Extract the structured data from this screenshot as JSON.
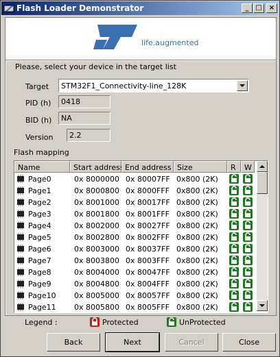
{
  "window": {
    "title": "Flash Loader Demonstrator",
    "controls": {
      "minimize": "_",
      "maximize": "□",
      "close": "×"
    }
  },
  "logo": {
    "tagline": "life.augmented",
    "brand_color": "#3a6fb0"
  },
  "form": {
    "instruction": "Please, select your device in the target list",
    "target_label": "Target",
    "target_value": "STM32F1_Connectivity-line_128K",
    "pid_label": "PID  (h)",
    "pid_value": "0418",
    "bid_label": "BID  (h)",
    "bid_value": "NA",
    "version_label": "Version",
    "version_value": "2.2"
  },
  "flash_mapping": {
    "title": "Flash mapping",
    "columns": [
      "Name",
      "Start address",
      "End address",
      "Size",
      "R",
      "W"
    ],
    "rows": [
      {
        "name": "Page0",
        "start": "0x 8000000",
        "end": "0x 80007FF",
        "size": "0x800 (2K)"
      },
      {
        "name": "Page1",
        "start": "0x 8000800",
        "end": "0x 8000FFF",
        "size": "0x800 (2K)"
      },
      {
        "name": "Page2",
        "start": "0x 8001000",
        "end": "0x 80017FF",
        "size": "0x800 (2K)"
      },
      {
        "name": "Page3",
        "start": "0x 8001800",
        "end": "0x 8001FFF",
        "size": "0x800 (2K)"
      },
      {
        "name": "Page4",
        "start": "0x 8002000",
        "end": "0x 80027FF",
        "size": "0x800 (2K)"
      },
      {
        "name": "Page5",
        "start": "0x 8002800",
        "end": "0x 8002FFF",
        "size": "0x800 (2K)"
      },
      {
        "name": "Page6",
        "start": "0x 8003000",
        "end": "0x 80037FF",
        "size": "0x800 (2K)"
      },
      {
        "name": "Page7",
        "start": "0x 8003800",
        "end": "0x 8003FFF",
        "size": "0x800 (2K)"
      },
      {
        "name": "Page8",
        "start": "0x 8004000",
        "end": "0x 80047FF",
        "size": "0x800 (2K)"
      },
      {
        "name": "Page9",
        "start": "0x 8004800",
        "end": "0x 8004FFF",
        "size": "0x800 (2K)"
      },
      {
        "name": "Page10",
        "start": "0x 8005000",
        "end": "0x 80057FF",
        "size": "0x800 (2K)"
      },
      {
        "name": "Page11",
        "start": "0x 8005800",
        "end": "0x 8005FFF",
        "size": "0x800 (2K)"
      }
    ]
  },
  "legend": {
    "label": "Legend :",
    "protected": "Protected",
    "unprotected": "UnProtected",
    "protected_color": "#c0201a",
    "unprotected_color": "#1f7a1f"
  },
  "buttons": {
    "back": "Back",
    "next": "Next",
    "cancel": "Cancel",
    "close": "Close"
  }
}
